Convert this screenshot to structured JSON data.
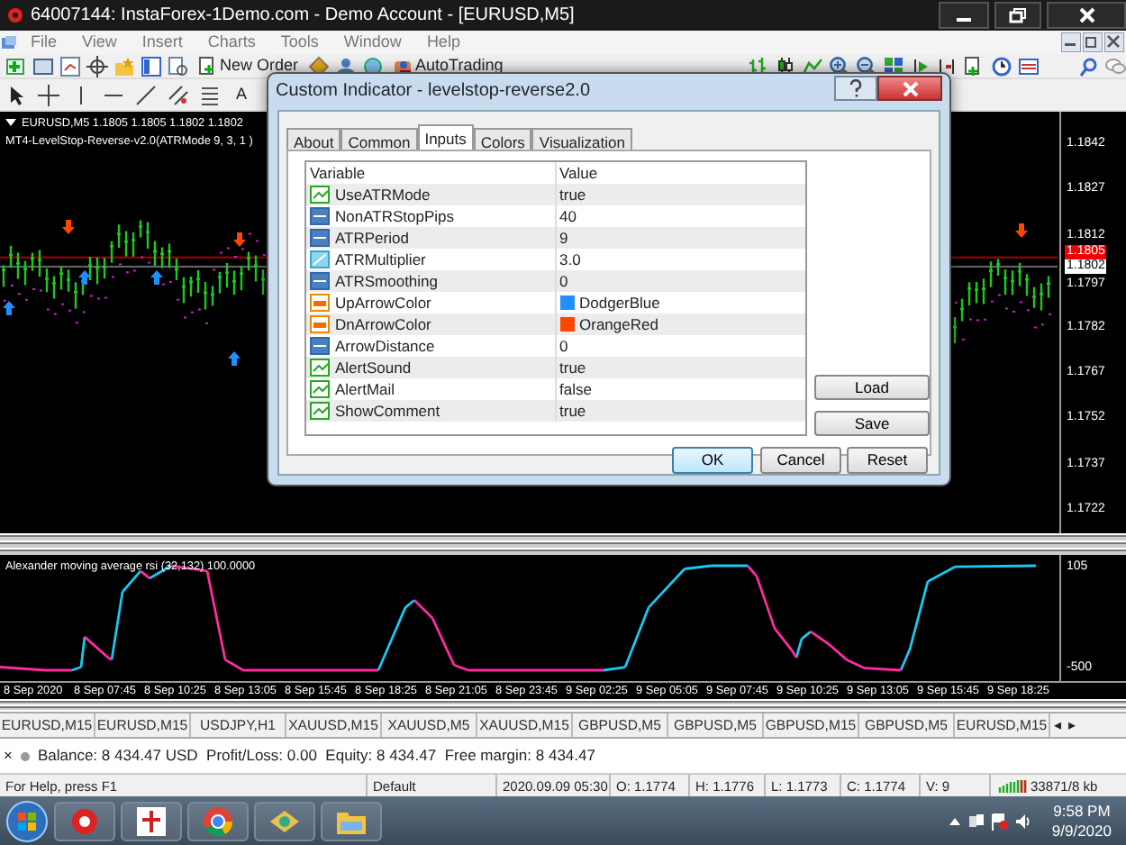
{
  "window": {
    "title": "64007144: InstaForex-1Demo.com - Demo Account - [EURUSD,M5]"
  },
  "menu": [
    "File",
    "View",
    "Insert",
    "Charts",
    "Tools",
    "Window",
    "Help"
  ],
  "toolbar": {
    "new_order": "New Order",
    "auto_trading": "AutoTrading",
    "text_tool": "A"
  },
  "chart": {
    "symbol_line": "EURUSD,M5  1.1805 1.1805 1.1802 1.1802",
    "indicator_line": "MT4-LevelStop-Reverse-v2.0(ATRMode 9, 3, 1 )",
    "price_labels": [
      {
        "text": "1.1842",
        "kind": "plain"
      },
      {
        "text": "1.1827",
        "kind": "plain"
      },
      {
        "text": "1.1812",
        "kind": "plain"
      },
      {
        "text": "1.1805",
        "kind": "ask"
      },
      {
        "text": "1.1802",
        "kind": "bid"
      },
      {
        "text": "1.1797",
        "kind": "plain"
      },
      {
        "text": "1.1782",
        "kind": "plain"
      },
      {
        "text": "1.1767",
        "kind": "plain"
      },
      {
        "text": "1.1752",
        "kind": "plain"
      },
      {
        "text": "1.1737",
        "kind": "plain"
      },
      {
        "text": "1.1722",
        "kind": "plain"
      }
    ]
  },
  "subwindow": {
    "title": "Alexander moving average rsi (32,132) 100.0000",
    "scale": [
      "105",
      "-500"
    ]
  },
  "time_labels": [
    "8 Sep 2020",
    "8 Sep 07:45",
    "8 Sep 10:25",
    "8 Sep 13:05",
    "8 Sep 15:45",
    "8 Sep 18:25",
    "8 Sep 21:05",
    "8 Sep 23:45",
    "9 Sep 02:25",
    "9 Sep 05:05",
    "9 Sep 07:45",
    "9 Sep 10:25",
    "9 Sep 13:05",
    "9 Sep 15:45",
    "9 Sep 18:25"
  ],
  "chart_tabs": [
    "EURUSD,M15",
    "EURUSD,M15",
    "USDJPY,H1",
    "XAUUSD,M15",
    "XAUUSD,M5",
    "XAUUSD,M15",
    "GBPUSD,M5",
    "GBPUSD,M5",
    "GBPUSD,M15",
    "GBPUSD,M5",
    "EURUSD,M15"
  ],
  "tab_scroll": [
    "◂",
    "▸"
  ],
  "terminal": {
    "close": "×",
    "summary": "Balance: 8 434.47 USD  Profit/Loss: 0.00  Equity: 8 434.47  Free margin: 8 434.47"
  },
  "status_bar": [
    "For Help, press F1",
    "Default",
    "2020.09.09 05:30",
    "O: 1.1774",
    "H: 1.1776",
    "L: 1.1773",
    "C: 1.1774",
    "V: 9",
    "33871/8 kb"
  ],
  "taskbar": {
    "time": "9:58 PM",
    "date": "9/9/2020"
  },
  "dialog": {
    "title": "Custom Indicator - levelstop-reverse2.0",
    "tabs": [
      {
        "label": "About",
        "selected": false
      },
      {
        "label": "Common",
        "selected": false
      },
      {
        "label": "Inputs",
        "selected": true
      },
      {
        "label": "Colors",
        "selected": false
      },
      {
        "label": "Visualization",
        "selected": false
      }
    ],
    "columns": [
      "Variable",
      "Value"
    ],
    "rows": [
      {
        "variable": "UseATRMode",
        "value": "true",
        "kind": "bool"
      },
      {
        "variable": "NonATRStopPips",
        "value": "40",
        "kind": "int"
      },
      {
        "variable": "ATRPeriod",
        "value": "9",
        "kind": "int"
      },
      {
        "variable": "ATRMultiplier",
        "value": "3.0",
        "kind": "double"
      },
      {
        "variable": "ATRSmoothing",
        "value": "0",
        "kind": "int"
      },
      {
        "variable": "UpArrowColor",
        "value": "DodgerBlue",
        "kind": "color",
        "color": "#1e90ff"
      },
      {
        "variable": "DnArrowColor",
        "value": "OrangeRed",
        "kind": "color",
        "color": "#ff4500"
      },
      {
        "variable": "ArrowDistance",
        "value": "0",
        "kind": "int"
      },
      {
        "variable": "AlertSound",
        "value": "true",
        "kind": "bool"
      },
      {
        "variable": "AlertMail",
        "value": "false",
        "kind": "bool"
      },
      {
        "variable": "ShowComment",
        "value": "true",
        "kind": "bool"
      }
    ],
    "side_buttons": [
      "Load",
      "Save"
    ],
    "buttons": [
      {
        "label": "OK",
        "kind": "default"
      },
      {
        "label": "Cancel",
        "kind": "normal"
      },
      {
        "label": "Reset",
        "kind": "normal"
      }
    ]
  }
}
